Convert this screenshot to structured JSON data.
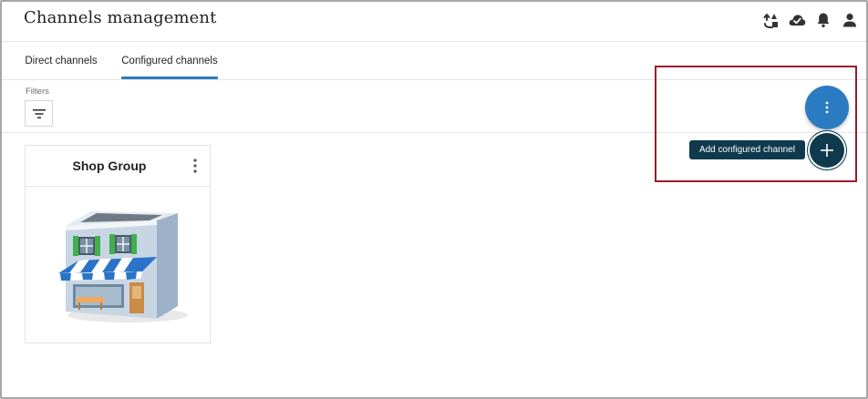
{
  "header": {
    "title": "Channels management",
    "icons": [
      "sync-icon",
      "cloud-check-icon",
      "bell-icon",
      "user-icon"
    ]
  },
  "tabs": [
    {
      "label": "Direct channels",
      "selected": false
    },
    {
      "label": "Configured channels",
      "selected": true
    }
  ],
  "filters": {
    "label": "Filters",
    "button_icon": "filter-icon"
  },
  "cards": [
    {
      "title": "Shop Group",
      "menu_icon": "more-vertical-icon",
      "image": "shop-building-illustration"
    }
  ],
  "fab": {
    "main_icon": "more-vertical-icon",
    "add_icon": "plus-icon",
    "tooltip": "Add configured channel"
  },
  "colors": {
    "accent": "#2b7bc2",
    "tab_indicator": "#2a7bbf",
    "dark_fab": "#0f3a4d",
    "highlight": "#9b1c2b",
    "tooltip_bg": "#0f3a4d"
  }
}
